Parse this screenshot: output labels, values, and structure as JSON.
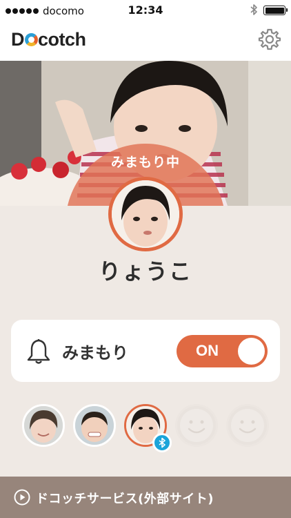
{
  "status_bar": {
    "carrier": "docomo",
    "time": "12:34",
    "battery_level": 1.0
  },
  "header": {
    "logo_text": "Docotch",
    "settings_icon": "gear-icon"
  },
  "profile": {
    "status_label": "みまもり中",
    "name": "りょうこ"
  },
  "watch": {
    "label": "みまもり",
    "toggle_label": "ON",
    "toggle_on": true
  },
  "children": [
    {
      "slot": "child-1",
      "selected": false
    },
    {
      "slot": "child-2",
      "selected": false
    },
    {
      "slot": "child-3",
      "selected": true,
      "badge": "bluetooth-icon"
    },
    {
      "slot": "empty-1",
      "placeholder_icon": "smiley-placeholder-icon"
    },
    {
      "slot": "empty-2",
      "placeholder_icon": "smiley-placeholder-icon"
    }
  ],
  "footer": {
    "label": "ドコッチサービス(外部サイト)",
    "icon": "play-circle-icon"
  },
  "colors": {
    "accent": "#e06a43",
    "background": "#efe9e4",
    "footer": "#97857b",
    "bluetooth": "#1ba4d9"
  }
}
